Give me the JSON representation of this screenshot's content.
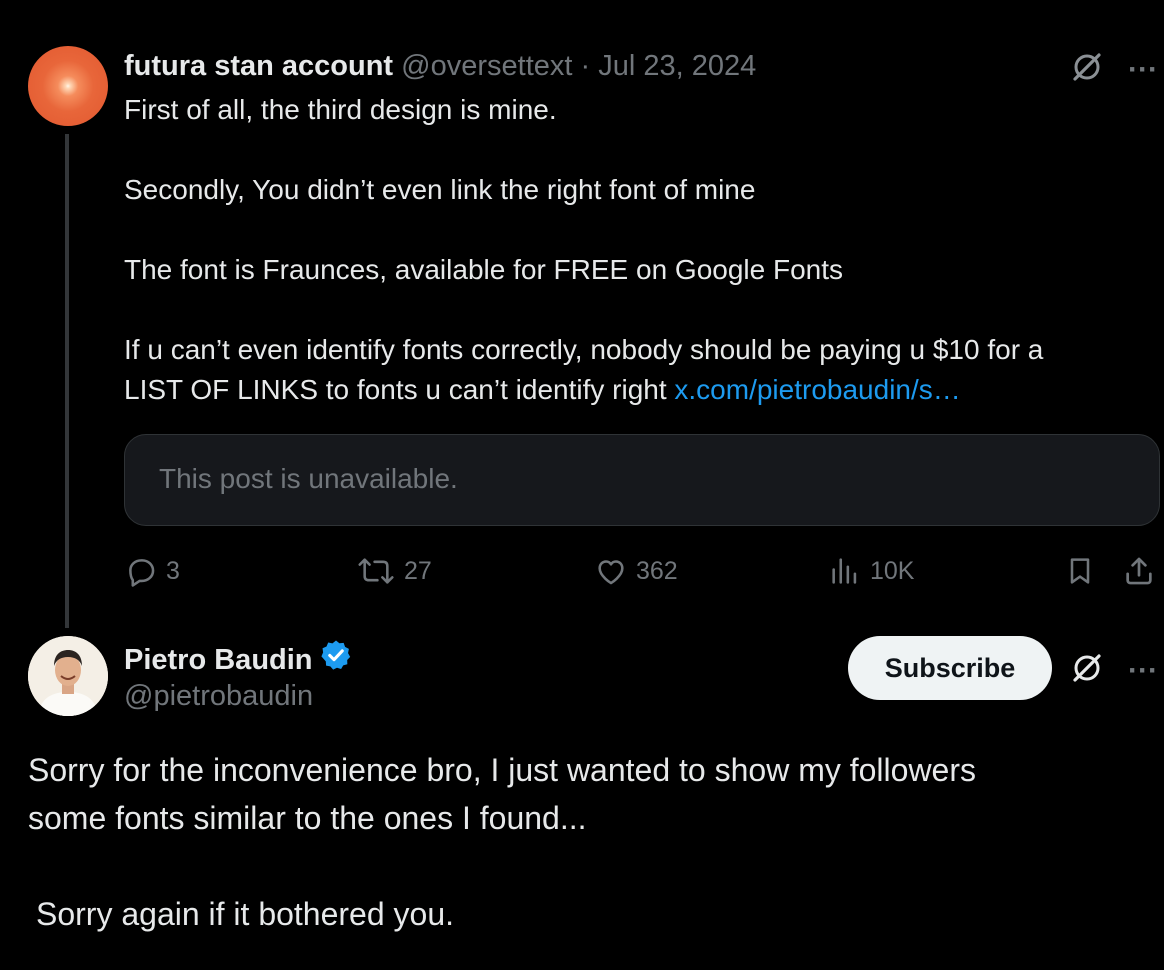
{
  "post1": {
    "author_name": "futura stan account",
    "handle": "@oversettext",
    "separator": "·",
    "date": "Jul 23, 2024",
    "lines": [
      "First of all, the third design is mine.",
      "Secondly, You didn’t even link the right font of mine",
      "The font is Fraunces, available for FREE on Google Fonts",
      "If u can’t even identify fonts correctly, nobody should be paying u $10 for a",
      "LIST OF LINKS to fonts u can’t identify right "
    ],
    "link_text": "x.com/pietrobaudin/s…",
    "quoted_unavailable": "This post is unavailable.",
    "stats": {
      "replies": "3",
      "reposts": "27",
      "likes": "362",
      "views": "10K"
    },
    "more_glyph": "···"
  },
  "post2": {
    "author_name": "Pietro Baudin",
    "handle": "@pietrobaudin",
    "subscribe_label": "Subscribe",
    "more_glyph": "···",
    "lines": [
      "Sorry for the inconvenience bro, I just wanted to show my followers",
      "some fonts similar to the ones I found...",
      "Sorry again if it bothered you."
    ]
  },
  "colors": {
    "background": "#000000",
    "text": "#e7e9ea",
    "muted": "#71767b",
    "link": "#1d9bf0",
    "verified": "#1d9bf0",
    "avatar_orange": "#e2582f"
  },
  "icons": [
    "reply-icon",
    "repost-icon",
    "like-icon",
    "views-icon",
    "bookmark-icon",
    "share-icon",
    "grok-icon",
    "more-icon",
    "verified-badge-icon"
  ]
}
